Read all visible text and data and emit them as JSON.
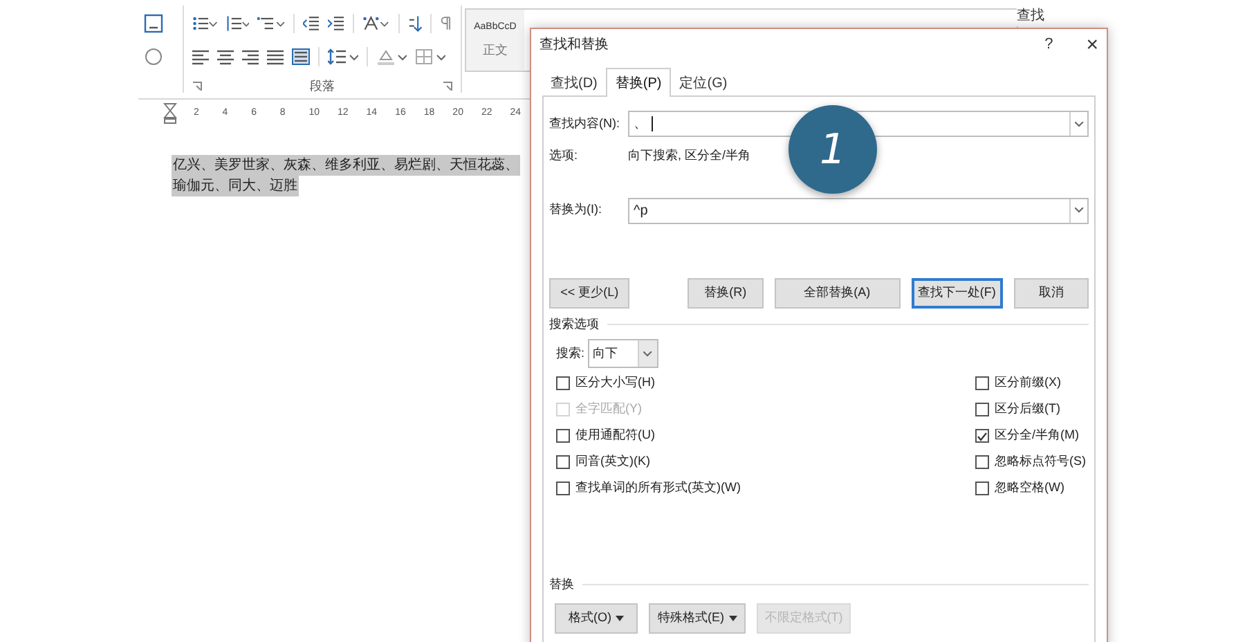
{
  "ribbon": {
    "group_label": "段落",
    "style_gallery": [
      {
        "preview": "AaBbCcD",
        "name": "正文"
      }
    ],
    "find_button": "查找"
  },
  "ruler": {
    "ticks": [
      "2",
      "4",
      "6",
      "8",
      "10",
      "12",
      "14",
      "16",
      "18",
      "20",
      "22",
      "24"
    ]
  },
  "document": {
    "lines": [
      {
        "text": "亿兴、美罗世家、灰森、维多利亚、易烂剧、天恒花蕊、",
        "selected": true
      },
      {
        "text": "瑜伽元、同大、迈胜",
        "selected": true
      }
    ]
  },
  "dialog": {
    "title": "查找和替换",
    "help": "?",
    "close": "×",
    "tabs": [
      {
        "label": "查找(D)",
        "selected": false
      },
      {
        "label": "替换(P)",
        "selected": true
      },
      {
        "label": "定位(G)",
        "selected": false
      }
    ],
    "find_label": "查找内容(N):",
    "find_value": "、",
    "options_label": "选项:",
    "options_value": "向下搜索, 区分全/半角",
    "replace_label": "替换为(I):",
    "replace_value": "^p",
    "buttons": [
      {
        "label": "<< 更少(L)",
        "default": false
      },
      {
        "label": "替换(R)",
        "default": false
      },
      {
        "label": "全部替换(A)",
        "default": false
      },
      {
        "label": "查找下一处(F)",
        "default": true
      },
      {
        "label": "取消",
        "default": false
      }
    ],
    "search_options_title": "搜索选项",
    "search_label": "搜索:",
    "search_direction": "向下",
    "options_left": [
      {
        "label": "区分大小写(H)",
        "checked": false,
        "disabled": false
      },
      {
        "label": "全字匹配(Y)",
        "checked": false,
        "disabled": true
      },
      {
        "label": "使用通配符(U)",
        "checked": false,
        "disabled": false
      },
      {
        "label": "同音(英文)(K)",
        "checked": false,
        "disabled": false
      },
      {
        "label": "查找单词的所有形式(英文)(W)",
        "checked": false,
        "disabled": false
      }
    ],
    "options_right": [
      {
        "label": "区分前缀(X)",
        "checked": false,
        "disabled": false
      },
      {
        "label": "区分后缀(T)",
        "checked": false,
        "disabled": false
      },
      {
        "label": "区分全/半角(M)",
        "checked": true,
        "disabled": false
      },
      {
        "label": "忽略标点符号(S)",
        "checked": false,
        "disabled": false
      },
      {
        "label": "忽略空格(W)",
        "checked": false,
        "disabled": false
      }
    ],
    "replace_section_title": "替换",
    "format_buttons": [
      {
        "label": "格式(O)",
        "dropdown": true,
        "disabled": false
      },
      {
        "label": "特殊格式(E)",
        "dropdown": true,
        "disabled": false
      },
      {
        "label": "不限定格式(T)",
        "dropdown": false,
        "disabled": true
      }
    ]
  },
  "step_marker": "1"
}
